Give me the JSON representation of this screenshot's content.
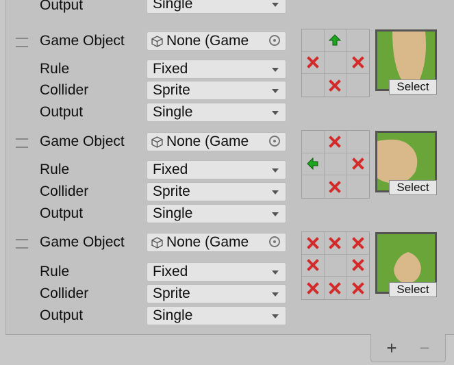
{
  "labels": {
    "game_object": "Game Object",
    "rule": "Rule",
    "collider": "Collider",
    "output": "Output"
  },
  "top_partial": {
    "output_value": "Single"
  },
  "tiles": [
    {
      "game_object_value": "None (Game",
      "rule_value": "Fixed",
      "collider_value": "Sprite",
      "output_value": "Single",
      "neighbors": [
        "",
        "up-arrow",
        "",
        "x",
        "",
        "x",
        "",
        "x",
        ""
      ],
      "select_label": "Select"
    },
    {
      "game_object_value": "None (Game",
      "rule_value": "Fixed",
      "collider_value": "Sprite",
      "output_value": "Single",
      "neighbors": [
        "",
        "x",
        "",
        "left-arrow",
        "",
        "x",
        "",
        "x",
        ""
      ],
      "select_label": "Select"
    },
    {
      "game_object_value": "None (Game",
      "rule_value": "Fixed",
      "collider_value": "Sprite",
      "output_value": "Single",
      "neighbors": [
        "x",
        "x",
        "x",
        "x",
        "",
        "x",
        "x",
        "x",
        "x"
      ],
      "select_label": "Select"
    }
  ],
  "footer": {
    "add_label": "+",
    "remove_label": "−"
  },
  "colors": {
    "x_mark": "#d42a2a",
    "arrow": "#1ea51e",
    "grass": "#6aa53a",
    "sand": "#d9b98a"
  }
}
